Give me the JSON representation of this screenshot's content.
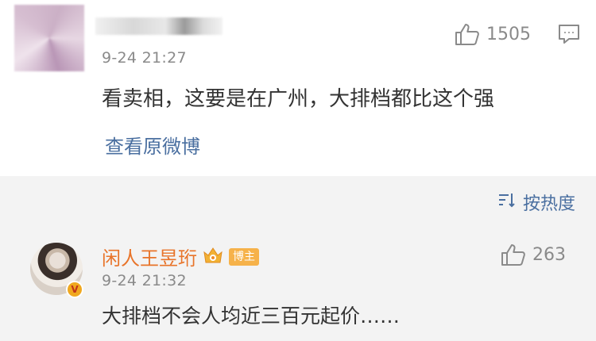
{
  "comment_1": {
    "time": "9-24 21:27",
    "like_count": "1505",
    "content": "看卖相，这要是在广州，大排档都比这个强",
    "view_original": "查看原微博"
  },
  "sort_label": "按热度",
  "comment_2": {
    "username": "闲人王昱珩",
    "host_badge": "博主",
    "verified_badge": "V",
    "time": "9-24 21:32",
    "like_count": "263",
    "content": "大排档不会人均近三百元起价……"
  },
  "colors": {
    "link": "#4a6fa0",
    "username": "#e8742a",
    "muted": "#8a8a8a",
    "background_lower": "#f3f3f3"
  }
}
